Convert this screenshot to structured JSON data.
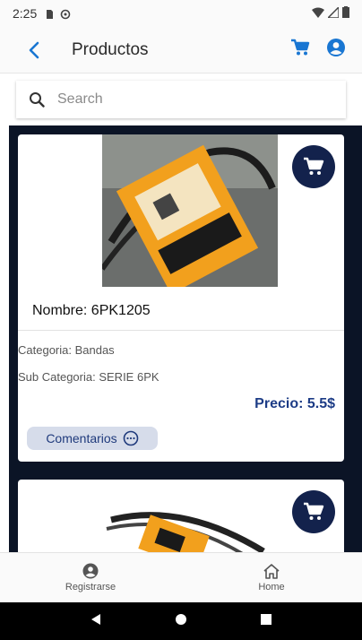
{
  "status_bar": {
    "time": "2:25"
  },
  "app_bar": {
    "title": "Productos",
    "back_icon": "chevron-left-icon",
    "cart_icon": "cart-icon",
    "account_icon": "account-circle-icon",
    "accent": "#1976d2"
  },
  "search": {
    "placeholder": "Search",
    "value": ""
  },
  "products": [
    {
      "name": "Nombre: 6PK1205",
      "category": "Categoria: Bandas",
      "subcategory": "Sub Categoria: SERIE 6PK",
      "price": "Precio: 5.5$",
      "comments_label": "Comentarios"
    }
  ],
  "bottom_nav": {
    "register_label": "Registrarse",
    "home_label": "Home"
  },
  "colors": {
    "fab": "#13224c",
    "price": "#1d3c86",
    "comments_bg": "#d6dcea",
    "list_bg": "#0b1426"
  }
}
